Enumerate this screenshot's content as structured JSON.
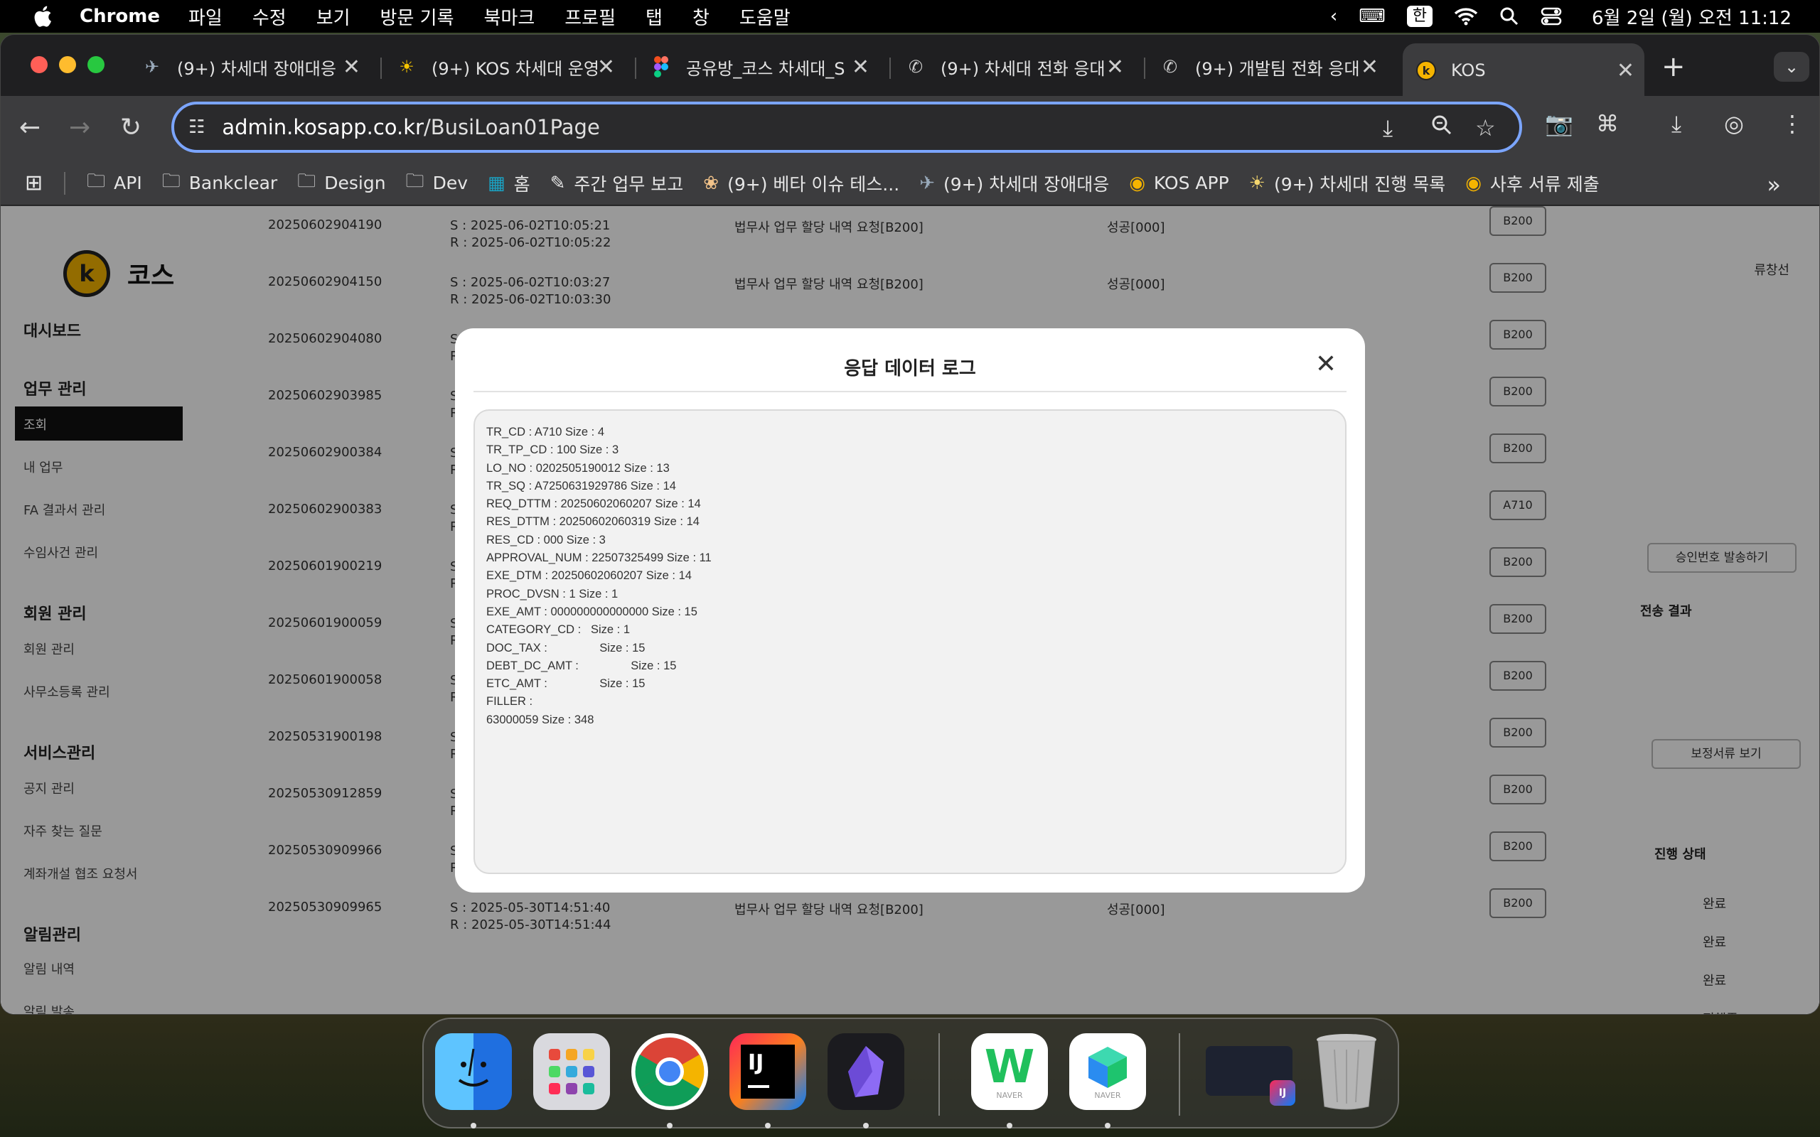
{
  "menubar": {
    "app": "Chrome",
    "items": [
      "파일",
      "수정",
      "보기",
      "방문 기록",
      "북마크",
      "프로필",
      "탭",
      "창",
      "도움말"
    ],
    "ime": "한",
    "clock": "6월 2일 (월) 오전 11:12"
  },
  "tabs": [
    {
      "icon": "wing-icon",
      "label": "(9+) 차세대 장애대응"
    },
    {
      "icon": "sun-icon",
      "label": "(9+) KOS 차세대 운영"
    },
    {
      "icon": "figma-icon",
      "label": "공유방_코스 차세대_S"
    },
    {
      "icon": "phone-icon",
      "label": "(9+) 차세대 전화 응대"
    },
    {
      "icon": "phone-icon",
      "label": "(9+) 개발팀 전화 응대"
    },
    {
      "icon": "kos-icon",
      "label": "KOS"
    }
  ],
  "address": {
    "host": "admin.kosapp.co.kr",
    "path": "/BusiLoan01Page"
  },
  "bookmarks": [
    {
      "icon": "folder-icon",
      "label": "API"
    },
    {
      "icon": "folder-icon",
      "label": "Bankclear"
    },
    {
      "icon": "folder-icon",
      "label": "Design"
    },
    {
      "icon": "folder-icon",
      "label": "Dev"
    },
    {
      "icon": "home-icon",
      "label": "홈"
    },
    {
      "icon": "memo-icon",
      "label": "주간 업무 보고"
    },
    {
      "icon": "pray-icon",
      "label": "(9+) 베타 이슈 테스..."
    },
    {
      "icon": "wing-icon",
      "label": "(9+) 차세대 장애대응"
    },
    {
      "icon": "kos-icon",
      "label": "KOS APP"
    },
    {
      "icon": "bulb-icon",
      "label": "(9+) 차세대 진행 목록"
    },
    {
      "icon": "kos-icon",
      "label": "사후 서류 제출"
    }
  ],
  "sidebar": {
    "brand": "코스",
    "sections": [
      {
        "title": "대시보드",
        "items": []
      },
      {
        "title": "업무 관리",
        "items": [
          "조회",
          "내 업무",
          "FA 결과서 관리",
          "수임사건 관리"
        ]
      },
      {
        "title": "회원 관리",
        "items": [
          "회원 관리",
          "사무소등록 관리"
        ]
      },
      {
        "title": "서비스관리",
        "items": [
          "공지 관리",
          "자주 찾는 질문",
          "계좌개설 협조 요청서"
        ]
      },
      {
        "title": "알림관리",
        "items": [
          "알림 내역",
          "알림 발송"
        ]
      }
    ]
  },
  "rows": [
    {
      "id": "20250602904190",
      "s": "S : 2025-06-02T10:05:21",
      "r": "R : 2025-06-02T10:05:22",
      "desc": "법무사 업무 할당 내역 요청[B200]",
      "result": "성공[000]",
      "code": "B200"
    },
    {
      "id": "20250602904150",
      "s": "S : 2025-06-02T10:03:27",
      "r": "R : 2025-06-02T10:03:30",
      "desc": "법무사 업무 할당 내역 요청[B200]",
      "result": "성공[000]",
      "code": "B200"
    },
    {
      "id": "20250602904080",
      "s": "S",
      "r": "R",
      "desc": "",
      "result": "",
      "code": "B200"
    },
    {
      "id": "20250602903985",
      "s": "S",
      "r": "R",
      "desc": "",
      "result": "",
      "code": "B200"
    },
    {
      "id": "20250602900384",
      "s": "S",
      "r": "R",
      "desc": "",
      "result": "",
      "code": "B200"
    },
    {
      "id": "20250602900383",
      "s": "S",
      "r": "R",
      "desc": "",
      "result": "",
      "code": "A710"
    },
    {
      "id": "20250601900219",
      "s": "S",
      "r": "R",
      "desc": "",
      "result": "",
      "code": "B200"
    },
    {
      "id": "20250601900059",
      "s": "S",
      "r": "R",
      "desc": "",
      "result": "",
      "code": "B200"
    },
    {
      "id": "20250601900058",
      "s": "S",
      "r": "R",
      "desc": "",
      "result": "",
      "code": "B200"
    },
    {
      "id": "20250531900198",
      "s": "S",
      "r": "R",
      "desc": "",
      "result": "",
      "code": "B200"
    },
    {
      "id": "20250530912859",
      "s": "S",
      "r": "R",
      "desc": "",
      "result": "",
      "code": "B200"
    },
    {
      "id": "20250530909966",
      "s": "S",
      "r": "R",
      "desc": "",
      "result": "",
      "code": "B200"
    },
    {
      "id": "20250530909965",
      "s": "S : 2025-05-30T14:51:40",
      "r": "R : 2025-05-30T14:51:44",
      "desc": "법무사 업무 할당 내역 요청[B200]",
      "result": "성공[000]",
      "code": "B200"
    }
  ],
  "right_panel": {
    "user": "류창선",
    "approval_button": "승인번호 발송하기",
    "transfer_label": "전송 결과",
    "docs_button": "보정서류 보기",
    "status_header": "진행 상태",
    "statuses": [
      "완료",
      "완료",
      "완료",
      "진행중"
    ]
  },
  "modal": {
    "title": "응답 데이터 로그",
    "lines": [
      "TR_CD : A710 Size : 4",
      "TR_TP_CD : 100 Size : 3",
      "LO_NO : 0202505190012 Size : 13",
      "TR_SQ : A7250631929786 Size : 14",
      "REQ_DTTM : 20250602060207 Size : 14",
      "RES_DTTM : 20250602060319 Size : 14",
      "RES_CD : 000 Size : 3",
      "APPROVAL_NUM : 22507325499 Size : 11",
      "EXE_DTM : 20250602060207 Size : 14",
      "PROC_DVSN : 1 Size : 1",
      "EXE_AMT : 000000000000000 Size : 15",
      "CATEGORY_CD :   Size : 1",
      "DOC_TAX :                Size : 15",
      "DEBT_DC_AMT :                Size : 15",
      "ETC_AMT :                Size : 15",
      "FILLER :",
      "63000059 Size : 348"
    ]
  },
  "dock": [
    {
      "name": "finder-icon"
    },
    {
      "name": "launchpad-icon"
    },
    {
      "name": "chrome-icon"
    },
    {
      "name": "intellij-icon"
    },
    {
      "name": "obsidian-icon"
    },
    {
      "name": "naver-works-icon",
      "label": "NAVER"
    },
    {
      "name": "naver-cube-icon",
      "label": "NAVER"
    },
    {
      "name": "intellij-window-thumbnail"
    },
    {
      "name": "trash-icon"
    }
  ]
}
